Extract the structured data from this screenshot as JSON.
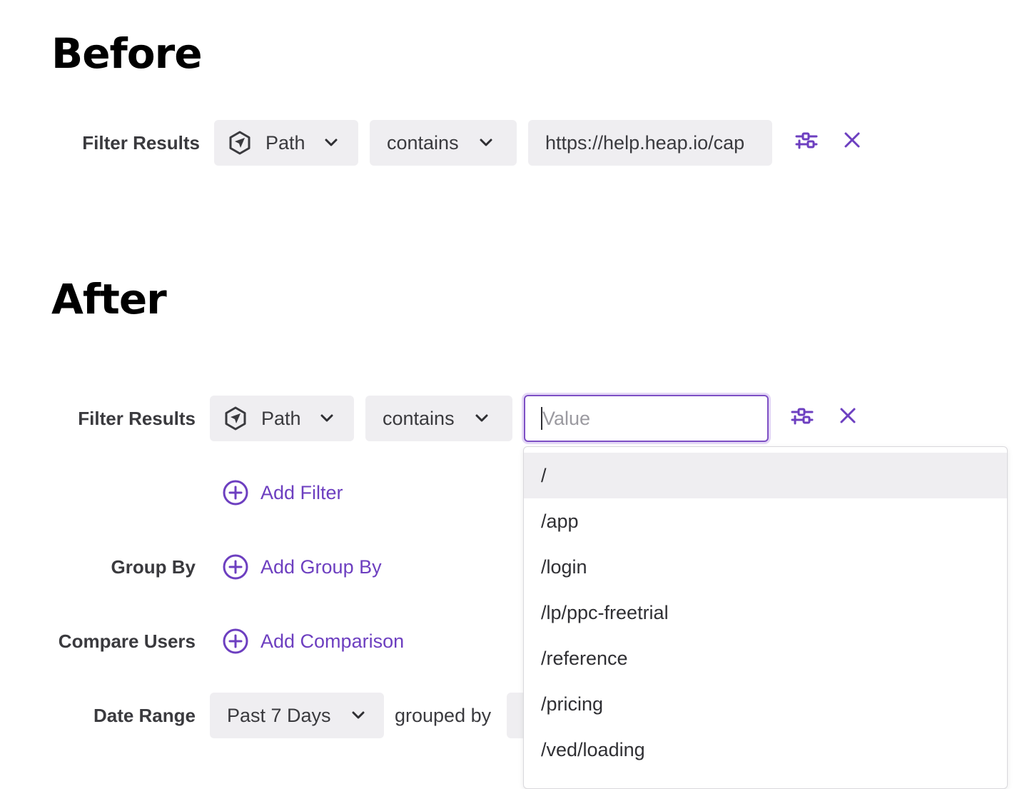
{
  "before": {
    "heading": "Before",
    "filter_label": "Filter Results",
    "property": "Path",
    "operator": "contains",
    "value": "https://help.heap.io/cap"
  },
  "after": {
    "heading": "After",
    "filter_label": "Filter Results",
    "property": "Path",
    "operator": "contains",
    "value_placeholder": "Value",
    "add_filter": "Add Filter",
    "group_by_label": "Group By",
    "add_group_by": "Add Group By",
    "compare_label": "Compare Users",
    "add_comparison": "Add Comparison",
    "date_label": "Date Range",
    "date_value": "Past 7 Days",
    "grouped_by": "grouped by"
  },
  "dropdown": {
    "options": [
      "/",
      "/app",
      "/login",
      "/lp/ppc-freetrial",
      "/reference",
      "/pricing",
      "/ved/loading"
    ],
    "highlighted_index": 0
  },
  "icons": {
    "property": "path-hexagon-icon",
    "options": "filter-options-icon",
    "remove": "close-icon",
    "add": "plus-circle-icon",
    "dropdown": "chevron-down-icon"
  },
  "colors": {
    "accent": "#6d3fc0",
    "pill_bg": "#efeef1",
    "heading": "#000000",
    "label": "#3a3a3e",
    "focus_border": "#7d4fc4"
  }
}
